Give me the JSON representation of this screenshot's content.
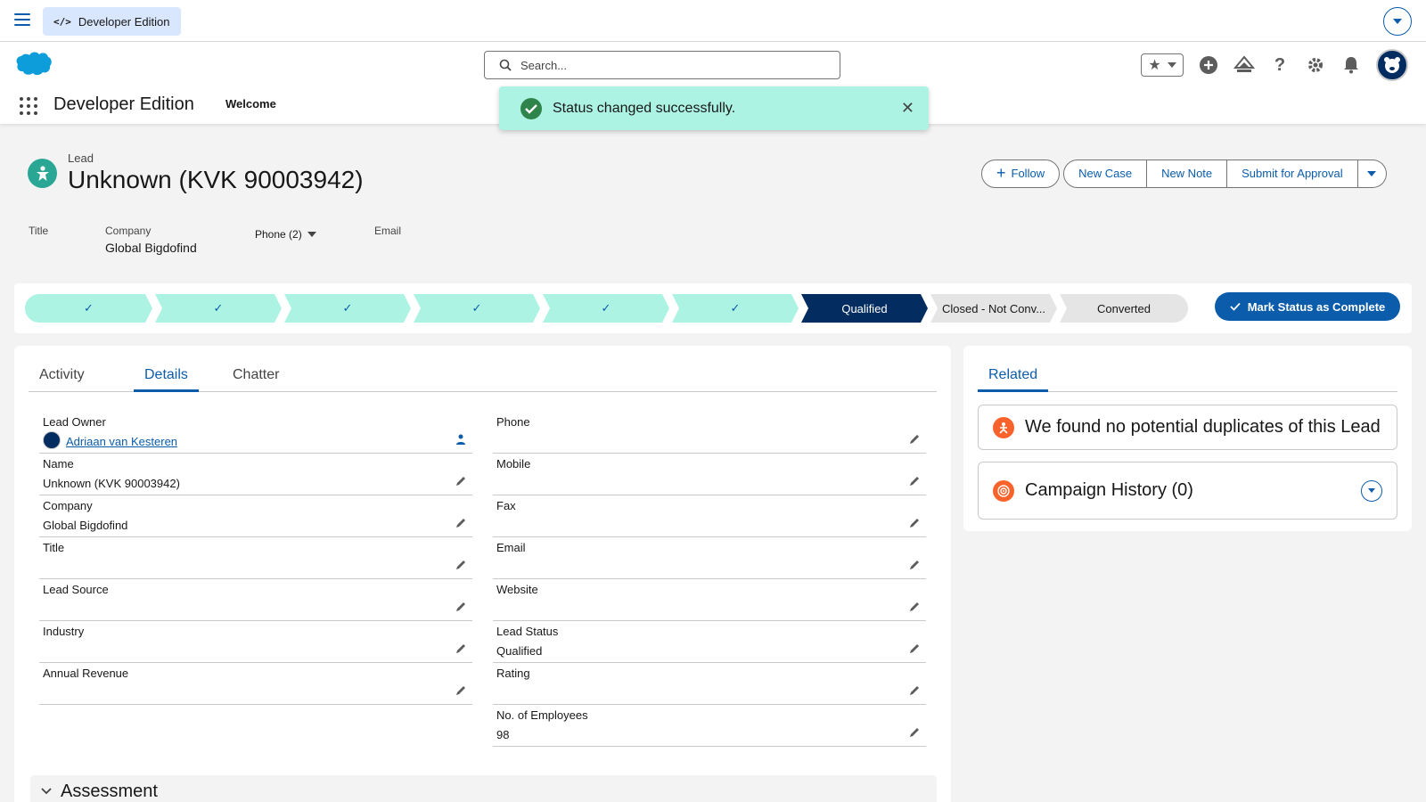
{
  "topbar": {
    "edition_label": "Developer Edition",
    "edition_icon": "</>"
  },
  "header": {
    "search_placeholder": "Search...",
    "app_name": "Developer Edition",
    "tabs": [
      {
        "label": "Welcome"
      }
    ]
  },
  "toast": {
    "message": "Status changed successfully.",
    "close": "✕"
  },
  "record": {
    "type": "Lead",
    "title": "Unknown (KVK 90003942)",
    "actions": {
      "follow": "Follow",
      "new_case": "New Case",
      "new_note": "New Note",
      "submit": "Submit for Approval"
    },
    "highlights": {
      "title_label": "Title",
      "company_label": "Company",
      "company_value": "Global Bigdofind",
      "phone_label": "Phone (2)",
      "email_label": "Email"
    }
  },
  "path": {
    "stages": [
      {
        "label": "✓",
        "state": "done"
      },
      {
        "label": "✓",
        "state": "done"
      },
      {
        "label": "✓",
        "state": "done"
      },
      {
        "label": "✓",
        "state": "done"
      },
      {
        "label": "✓",
        "state": "done"
      },
      {
        "label": "✓",
        "state": "done"
      },
      {
        "label": "Qualified",
        "state": "current"
      },
      {
        "label": "Closed - Not Conv...",
        "state": "todo"
      },
      {
        "label": "Converted",
        "state": "todo"
      }
    ],
    "mark_button": "Mark Status as Complete"
  },
  "main": {
    "tabs": {
      "activity": "Activity",
      "details": "Details",
      "chatter": "Chatter"
    },
    "left_fields": [
      {
        "label": "Lead Owner",
        "value": "Adriaan van Kesteren"
      },
      {
        "label": "Name",
        "value": "Unknown (KVK 90003942)"
      },
      {
        "label": "Company",
        "value": "Global Bigdofind"
      },
      {
        "label": "Title",
        "value": ""
      },
      {
        "label": "Lead Source",
        "value": ""
      },
      {
        "label": "Industry",
        "value": ""
      },
      {
        "label": "Annual Revenue",
        "value": ""
      }
    ],
    "right_fields": [
      {
        "label": "Phone",
        "value": ""
      },
      {
        "label": "Mobile",
        "value": ""
      },
      {
        "label": "Fax",
        "value": ""
      },
      {
        "label": "Email",
        "value": ""
      },
      {
        "label": "Website",
        "value": ""
      },
      {
        "label": "Lead Status",
        "value": "Qualified"
      },
      {
        "label": "Rating",
        "value": ""
      },
      {
        "label": "No. of Employees",
        "value": "98"
      }
    ],
    "section": "Assessment"
  },
  "related": {
    "tab": "Related",
    "duplicates": "We found no potential duplicates of this Lead",
    "campaign": "Campaign History (0)"
  },
  "colors": {
    "brand": "#0b5cab",
    "path_done": "#acf3e4",
    "path_current": "#032d60",
    "toast_bg": "#acf3e4"
  }
}
